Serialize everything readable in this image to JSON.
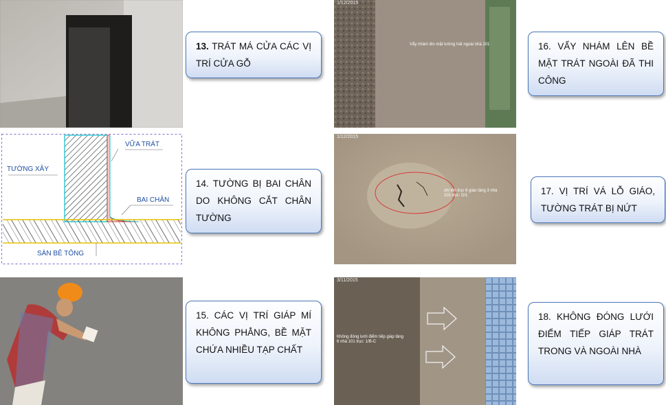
{
  "items": [
    {
      "num": "13.",
      "text": " TRÁT MÁ CỬA CÁC VỊ TRÍ CỬA GỖ"
    },
    {
      "text": "14. TƯỜNG BỊ BAI CHÂN DO KHÔNG CẮT CHÂN TƯỜNG"
    },
    {
      "text": "15. CÁC VỊ TRÍ GIÁP MÍ KHÔNG PHẲNG, BỀ MẶT CHỨA NHIỀU TẠP CHẤT"
    },
    {
      "text": "16. VẨY NHÁM LÊN BỀ MẶT TRÁT NGOÀI ĐÃ THI CÔNG"
    },
    {
      "text": "17. VỊ TRÍ VÁ LỖ GIÁO, TƯỜNG TRÁT BỊ NỨT"
    },
    {
      "text": "18. KHÔNG ĐÓNG LƯỚI ĐIỂM TIẾP GIÁP TRÁT TRONG VÀ NGOÀI NHÀ"
    }
  ],
  "diagram": {
    "wall_label": "TƯỜNG XÂY",
    "plaster_label": "VỮA TRÁT",
    "bai_chan_label": "BAI CHÂN",
    "floor_label": "SÀN BÊ TÔNG"
  },
  "photos": {
    "p16": {
      "date": "1/12/2015",
      "note": "Vẩy nhám lên mặt tường trát ngoài nhà 101"
    },
    "p17": {
      "date": "1/12/2015",
      "note": "chi tên trục 6 giáo tầng 3 nhà 101 trục: D/1"
    },
    "p18": {
      "date": "3/11/2015",
      "note": "Không đóng lưới điểm tiếp giáp tầng 6 nhà 101 trục: 1/B-C"
    }
  }
}
